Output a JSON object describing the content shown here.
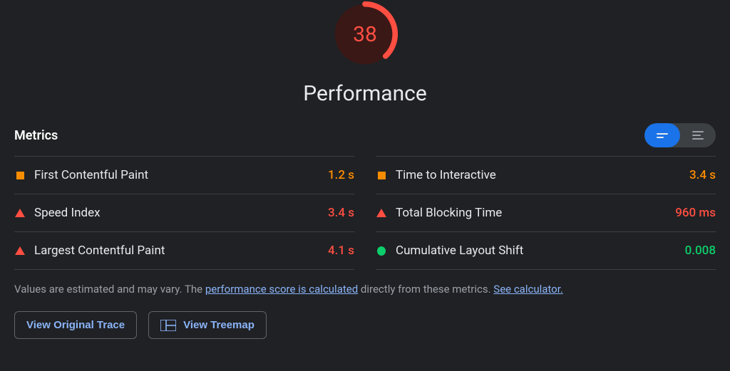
{
  "gauge": {
    "score": "38",
    "score_num": 38,
    "title": "Performance",
    "color": "#ff4e42",
    "bg_fill": "#3a1816"
  },
  "metrics_header": {
    "label": "Metrics"
  },
  "metrics": {
    "left": [
      {
        "status": "average",
        "name": "First Contentful Paint",
        "value": "1.2 s",
        "value_class": "val-orange"
      },
      {
        "status": "poor",
        "name": "Speed Index",
        "value": "3.4 s",
        "value_class": "val-red"
      },
      {
        "status": "poor",
        "name": "Largest Contentful Paint",
        "value": "4.1 s",
        "value_class": "val-red"
      }
    ],
    "right": [
      {
        "status": "average",
        "name": "Time to Interactive",
        "value": "3.4 s",
        "value_class": "val-orange"
      },
      {
        "status": "poor",
        "name": "Total Blocking Time",
        "value": "960 ms",
        "value_class": "val-red"
      },
      {
        "status": "good",
        "name": "Cumulative Layout Shift",
        "value": "0.008",
        "value_class": "val-green"
      }
    ]
  },
  "note": {
    "prefix": "Values are estimated and may vary. The ",
    "link1": "performance score is calculated",
    "mid": " directly from these metrics. ",
    "link2": "See calculator."
  },
  "actions": {
    "view_trace": "View Original Trace",
    "view_treemap": "View Treemap"
  }
}
